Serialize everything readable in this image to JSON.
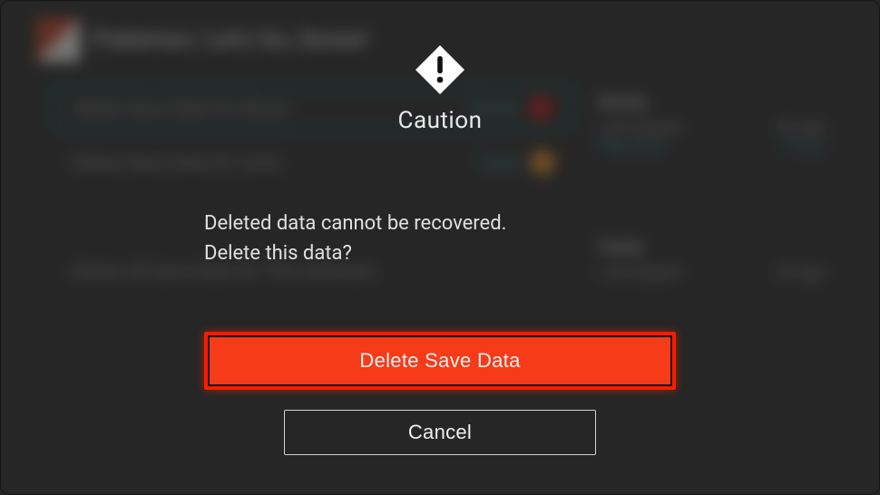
{
  "modal": {
    "title": "Caution",
    "message_line1": "Deleted data cannot be recovered.",
    "message_line2": "Delete this data?",
    "primary_label": "Delete Save Data",
    "secondary_label": "Cancel"
  },
  "background": {
    "header_title": "Pokémon: Let's Go, Eevee!",
    "row1_label": "Delete Save Data for Eevee",
    "row1_tag": "Eevee",
    "row2_label": "Delete Save Data for Carty",
    "row2_tag": "Carty",
    "row3_label": "Delete All Save Data for This Software",
    "side1_name": "Eevee",
    "side1_key": "Last played",
    "side1_val": "4d ago",
    "side1_key2": "Play time",
    "side1_val2": "1 hour",
    "side2_name": "Carty",
    "side2_key": "Last played",
    "side2_val": "4d ago"
  },
  "colors": {
    "primary_fill": "#f53b18",
    "primary_border": "#ff1a00"
  }
}
